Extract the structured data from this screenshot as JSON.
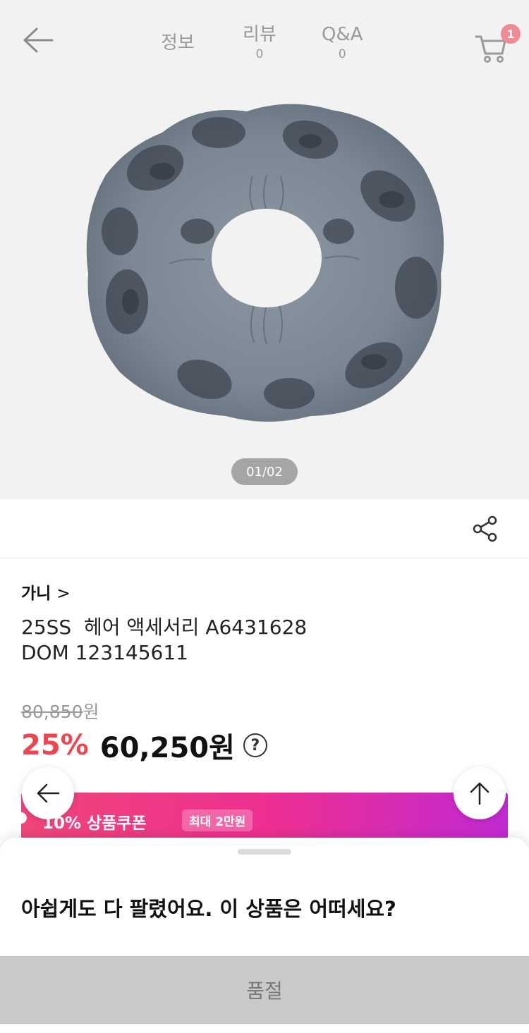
{
  "nav": {
    "back_icon": "arrow-left-icon",
    "tabs": [
      {
        "label": "정보",
        "count": ""
      },
      {
        "label": "리뷰",
        "count": "0"
      },
      {
        "label": "Q&A",
        "count": "0"
      }
    ],
    "cart_icon": "cart-icon",
    "cart_badge": "1"
  },
  "gallery": {
    "pager": "01/02"
  },
  "share_icon": "share-icon",
  "product": {
    "brand": "가니",
    "brand_chevron": ">",
    "name_line1": "25SS  헤어 액세서리 A6431628",
    "name_line2": "DOM 123145611",
    "original_price": "80,850",
    "currency": "원",
    "discount": "25%",
    "sale_price": "60,250원",
    "help": "?"
  },
  "coupon": {
    "label": "10% 상품쿠폰",
    "max": "최대 2만원"
  },
  "floating": {
    "prev_icon": "arrow-left-icon",
    "top_icon": "arrow-up-icon"
  },
  "sheet": {
    "title": "아쉽게도 다 팔렸어요. 이 상품은 어떠세요?",
    "soldout_button": "품절"
  },
  "colors": {
    "discount": "#ef4451",
    "coupon_start": "#f1457a",
    "coupon_end": "#c229d4",
    "badge": "#f08a95",
    "soldout_bg": "#c9c9c9"
  }
}
